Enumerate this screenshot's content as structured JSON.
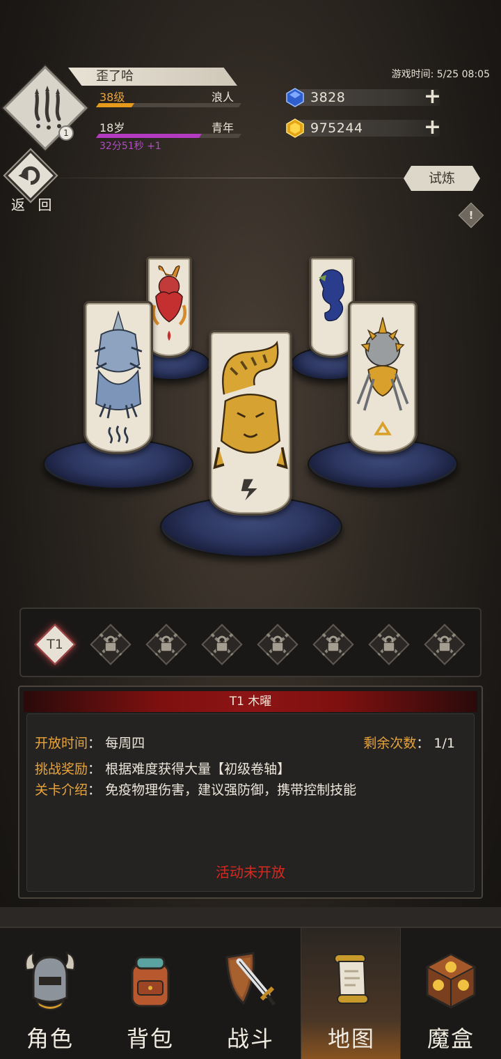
{
  "player": {
    "name": "歪了哈",
    "level_text": "38级",
    "class_text": "浪人",
    "age_text": "18岁",
    "age_stage": "青年",
    "timer_text": "32分51秒 +1",
    "badge_count": "1",
    "level_progress": 0.25,
    "age_progress": 0.72
  },
  "game_time": "游戏时间: 5/25 08:05",
  "currencies": [
    {
      "name": "diamond",
      "value": "3828",
      "color": "#3b6fd8"
    },
    {
      "name": "gold",
      "value": "975244",
      "color": "#e9b824"
    }
  ],
  "nav_back_label": "返 回",
  "trial_button": "试炼",
  "tiers": {
    "active_label": "T1",
    "locked_count": 7
  },
  "stage": {
    "title": "T1 木曜",
    "open_time_key": "开放时间",
    "open_time_value": "每周四",
    "remaining_key": "剩余次数",
    "remaining_value": "1/1",
    "reward_key": "挑战奖励",
    "reward_value": "根据难度获得大量【初级卷轴】",
    "intro_key": "关卡介绍",
    "intro_value": "免疫物理伤害，建议强防御，携带控制技能",
    "status": "活动未开放"
  },
  "bottom_nav": [
    {
      "label": "角色",
      "icon": "helmet-icon",
      "active": false
    },
    {
      "label": "背包",
      "icon": "backpack-icon",
      "active": false
    },
    {
      "label": "战斗",
      "icon": "sword-shield-icon",
      "active": false
    },
    {
      "label": "地图",
      "icon": "scroll-map-icon",
      "active": true
    },
    {
      "label": "魔盒",
      "icon": "magic-box-icon",
      "active": false
    }
  ],
  "colors": {
    "accent_orange": "#e8a43c",
    "level_bar": "#e69a1c",
    "age_bar": "#b23bc0",
    "alert_red": "#d8291f",
    "title_bar": "#8d1414"
  }
}
